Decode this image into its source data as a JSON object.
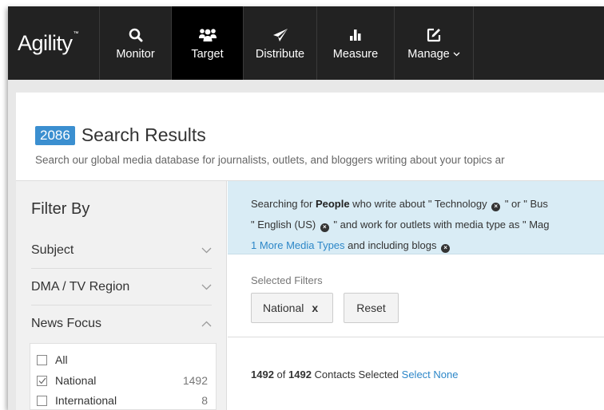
{
  "brand": {
    "name": "Agility",
    "tm": "™"
  },
  "nav": {
    "monitor": {
      "label": "Monitor",
      "icon": "search-icon"
    },
    "target": {
      "label": "Target",
      "icon": "people-icon"
    },
    "distribute": {
      "label": "Distribute",
      "icon": "paper-plane-icon"
    },
    "measure": {
      "label": "Measure",
      "icon": "bar-chart-icon"
    },
    "manage": {
      "label": "Manage",
      "icon": "edit-icon",
      "chevron": "⌄"
    }
  },
  "header": {
    "count": "2086",
    "title": "Search Results",
    "subtitle": "Search our global media database for journalists, outlets, and bloggers writing about your topics ar"
  },
  "sidebar": {
    "title": "Filter By",
    "sections": [
      {
        "label": "Subject",
        "expanded": false
      },
      {
        "label": "DMA / TV Region",
        "expanded": false
      },
      {
        "label": "News Focus",
        "expanded": true
      }
    ],
    "news_focus_options": [
      {
        "label": "All",
        "count": "",
        "checked": false
      },
      {
        "label": "National",
        "count": "1492",
        "checked": true
      },
      {
        "label": "International",
        "count": "8",
        "checked": false
      }
    ]
  },
  "search_summary": {
    "p1": "Searching for ",
    "entity": "People",
    "p2": " who write about \" Technology ",
    "p3": " \" or \" Bus",
    "p4": "\" English (US) ",
    "p5": " \"  and work for outlets with media type as \" Mag",
    "more_link": "1 More Media Types",
    "p6": "  and including blogs "
  },
  "selected_filters": {
    "label": "Selected Filters",
    "chip": "National",
    "chip_remove": "x",
    "reset": "Reset"
  },
  "selection": {
    "selected": "1492",
    "of": " of ",
    "total": "1492",
    "suffix": " Contacts Selected ",
    "select_none": "Select None"
  },
  "colors": {
    "nav_bg": "#222222",
    "nav_active": "#000000",
    "badge": "#3b8fd0",
    "search_box": "#d9ecf5",
    "link": "#2d87c8"
  }
}
